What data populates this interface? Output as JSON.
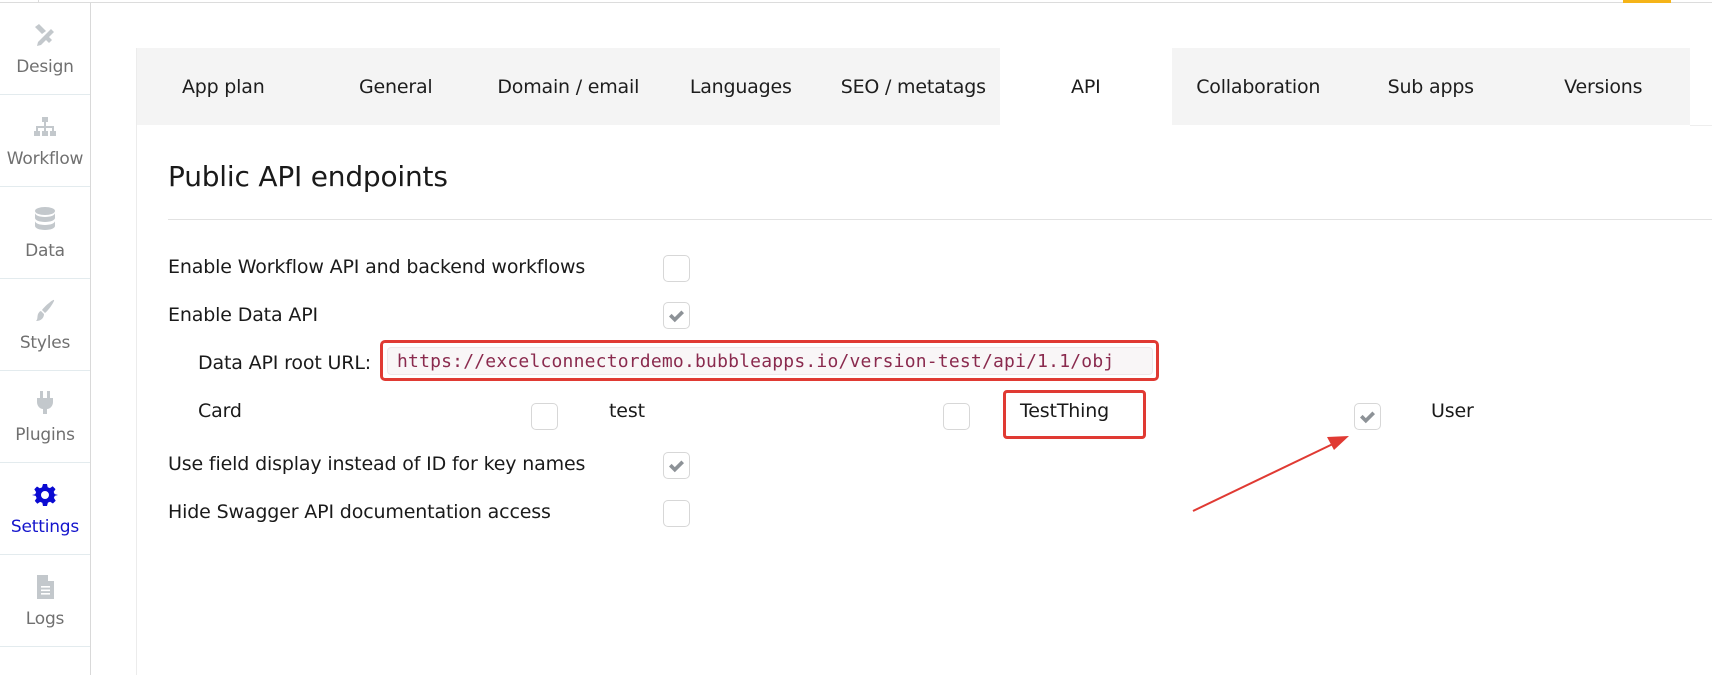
{
  "sidebar": {
    "items": [
      {
        "label": "Design",
        "icon": "design-icon",
        "active": false
      },
      {
        "label": "Workflow",
        "icon": "workflow-icon",
        "active": false
      },
      {
        "label": "Data",
        "icon": "database-icon",
        "active": false
      },
      {
        "label": "Styles",
        "icon": "brush-icon",
        "active": false
      },
      {
        "label": "Plugins",
        "icon": "plug-icon",
        "active": false
      },
      {
        "label": "Settings",
        "icon": "gear-icon",
        "active": true
      },
      {
        "label": "Logs",
        "icon": "document-icon",
        "active": false
      }
    ]
  },
  "tabs": [
    {
      "label": "App plan",
      "active": false
    },
    {
      "label": "General",
      "active": false
    },
    {
      "label": "Domain / email",
      "active": false
    },
    {
      "label": "Languages",
      "active": false
    },
    {
      "label": "SEO / metatags",
      "active": false
    },
    {
      "label": "API",
      "active": true
    },
    {
      "label": "Collaboration",
      "active": false
    },
    {
      "label": "Sub apps",
      "active": false
    },
    {
      "label": "Versions",
      "active": false
    }
  ],
  "section": {
    "title": "Public API endpoints"
  },
  "settings": {
    "workflow_api": {
      "label": "Enable Workflow API and backend workflows",
      "checked": false
    },
    "data_api": {
      "label": "Enable Data API",
      "checked": true
    },
    "data_api_url": {
      "label": "Data API root URL:",
      "value": "https://excelconnectordemo.bubbleapps.io/version-test/api/1.1/obj"
    },
    "data_types": [
      {
        "label": "Card",
        "checked": false
      },
      {
        "label": "test",
        "checked": false
      },
      {
        "label": "TestThing",
        "checked": true
      },
      {
        "label": "User",
        "checked": false
      }
    ],
    "field_display": {
      "label": "Use field display instead of ID for key names",
      "checked": true
    },
    "hide_swagger": {
      "label": "Hide Swagger API documentation access",
      "checked": false
    }
  },
  "colors": {
    "accent_active": "#1414cc",
    "annotation_red": "#e03a33",
    "top_accent": "#f5b418"
  }
}
